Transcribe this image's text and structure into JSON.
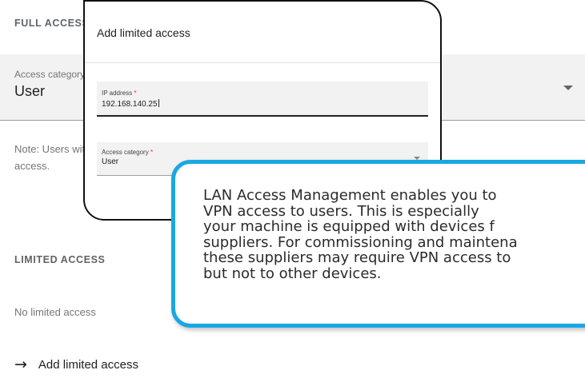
{
  "page": {
    "full_access": {
      "title": "FULL ACCESS",
      "select_label": "Access category *",
      "select_value": "User",
      "note_line1": "Note: Users with the access category 'Administrator' are always granted full",
      "note_line2": "access."
    },
    "limited_access": {
      "title": "LIMITED ACCESS",
      "empty_text": "No limited access",
      "add_label": "Add limited access"
    }
  },
  "dialog": {
    "title": "Add limited access",
    "ip_field": {
      "label": "IP address",
      "required_mark": "*",
      "value": "192.168.140.25"
    },
    "category_field": {
      "label": "Access category",
      "required_mark": "*",
      "value": "User"
    }
  },
  "callout": {
    "lines": [
      "LAN Access Management enables you to",
      "VPN access to users. This is especially",
      "your machine is equipped with devices f",
      "suppliers. For commissioning and maintena",
      "these suppliers may require VPN access to",
      "but not to other devices."
    ],
    "border_color": "#1aa7e3"
  },
  "icons": {
    "add": "arrow-right-icon",
    "select": "chevron-down-icon"
  }
}
